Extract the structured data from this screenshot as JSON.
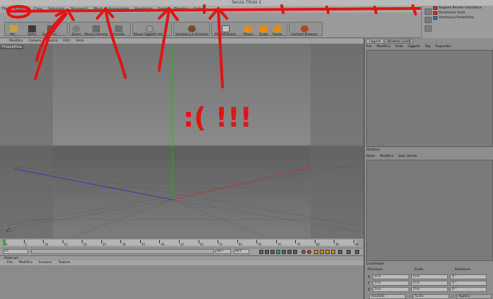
{
  "window": {
    "title": "Senza Titolo 1"
  },
  "menu": {
    "items": [
      "File",
      "Modifica",
      "Crea",
      "Selezione",
      "Strumenti",
      "Mesh",
      "Animazione",
      "Rendering",
      "Script",
      "Finestra",
      "Aiuto"
    ]
  },
  "layouts": {
    "items": [
      "Regione Render Interattiva",
      "Renderizza Vista",
      "Interfaccia Predefinita"
    ]
  },
  "toolbar": {
    "buttons": [
      "Att...",
      "Salva",
      "Salva Inc...",
      "Zoom",
      "Muovi camera",
      "Annulla",
      "Muovi Oggetti Att...",
      "Seleziona e Formula",
      "Modellazione",
      "Muovi",
      "Scala",
      "Ruota",
      "Content Browser"
    ]
  },
  "viewport": {
    "menu": [
      "Modifica",
      "Camera",
      "Mostra",
      "Filtri",
      "Vista"
    ],
    "label": "Prospettiva"
  },
  "timeline": {
    "ticks": [
      "0",
      "5",
      "10",
      "15",
      "20",
      "25",
      "30",
      "35",
      "40",
      "45",
      "50",
      "55",
      "60",
      "65",
      "70",
      "75",
      "80",
      "85",
      "90"
    ],
    "current_frame": "0 F",
    "start_field": "0 F",
    "end_field": "90 F",
    "end_field2": "90 F",
    "frame_label": "0 F"
  },
  "materials": {
    "title": "Materiali",
    "menu": [
      "File",
      "Modifica",
      "Funzioni",
      "Texture"
    ]
  },
  "objects": {
    "tabs": [
      "Oggetti",
      "Browser Livelli"
    ],
    "menu": [
      "File",
      "Modifica",
      "Vista",
      "Oggetti",
      "Tag",
      "Segnalibri"
    ]
  },
  "attributes": {
    "title": "Attributi",
    "menu": [
      "Modo",
      "Modifica",
      "Dati Utente"
    ]
  },
  "coordinates": {
    "title": "Coordinate",
    "headers": [
      "Posizione",
      "Scala",
      "Rotazione"
    ],
    "rows": [
      {
        "axis": "X",
        "pos": "0 m",
        "scale": "0 m",
        "rot": "0 °"
      },
      {
        "axis": "Y",
        "pos": "0 m",
        "scale": "0 m",
        "rot": "0 °"
      },
      {
        "axis": "Z",
        "pos": "0 m",
        "scale": "0 m",
        "rot": "0 °"
      }
    ],
    "mode": "Assoluto",
    "mode2": "Scala",
    "apply": "Applica"
  },
  "annotation": {
    "text": ":( !!!"
  },
  "colors": {
    "annotation_red": "#e11414",
    "axis_green": "#1fb51f",
    "axis_red": "#c42a2a",
    "axis_blue": "#2a2ac4",
    "accent_orange": "#e48b14"
  }
}
